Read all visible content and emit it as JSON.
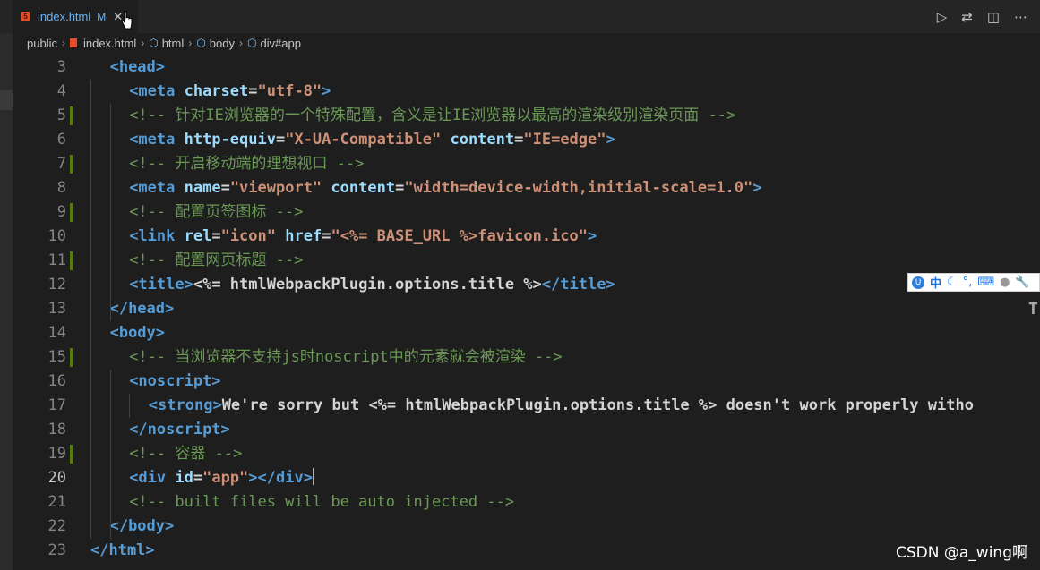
{
  "tab": {
    "file_name": "index.html",
    "modified_flag": "M",
    "file_icon": "html5-icon",
    "close_icon": "close-icon"
  },
  "toolbar": {
    "icons": [
      "run-icon",
      "compare-changes-icon",
      "split-editor-icon",
      "more-icon"
    ]
  },
  "breadcrumb": {
    "items": [
      "public",
      "index.html",
      "html",
      "body",
      "div#app"
    ]
  },
  "editor": {
    "active_line": 20,
    "lines": [
      {
        "num": "3",
        "tokens": [
          {
            "cls": "t",
            "text": "<head>"
          }
        ]
      },
      {
        "num": "4",
        "tokens": [
          {
            "cls": "t",
            "text": "<meta "
          },
          {
            "cls": "a",
            "text": "charset"
          },
          {
            "cls": "txt",
            "text": "="
          },
          {
            "cls": "s",
            "text": "\"utf-8\""
          },
          {
            "cls": "t",
            "text": ">"
          }
        ]
      },
      {
        "num": "5",
        "tokens": [
          {
            "cls": "c",
            "text": "<!-- 针对IE浏览器的一个特殊配置，含义是让IE浏览器以最高的渲染级别渲染页面 -->"
          }
        ]
      },
      {
        "num": "6",
        "tokens": [
          {
            "cls": "t",
            "text": "<meta "
          },
          {
            "cls": "a",
            "text": "http-equiv"
          },
          {
            "cls": "txt",
            "text": "="
          },
          {
            "cls": "s",
            "text": "\"X-UA-Compatible\""
          },
          {
            "cls": "txt",
            "text": " "
          },
          {
            "cls": "a",
            "text": "content"
          },
          {
            "cls": "txt",
            "text": "="
          },
          {
            "cls": "s",
            "text": "\"IE=edge\""
          },
          {
            "cls": "t",
            "text": ">"
          }
        ]
      },
      {
        "num": "7",
        "tokens": [
          {
            "cls": "c",
            "text": "<!-- 开启移动端的理想视口 -->"
          }
        ]
      },
      {
        "num": "8",
        "tokens": [
          {
            "cls": "t",
            "text": "<meta "
          },
          {
            "cls": "a",
            "text": "name"
          },
          {
            "cls": "txt",
            "text": "="
          },
          {
            "cls": "s",
            "text": "\"viewport\""
          },
          {
            "cls": "txt",
            "text": " "
          },
          {
            "cls": "a",
            "text": "content"
          },
          {
            "cls": "txt",
            "text": "="
          },
          {
            "cls": "s",
            "text": "\"width=device-width,initial-scale=1.0\""
          },
          {
            "cls": "t",
            "text": ">"
          }
        ]
      },
      {
        "num": "9",
        "tokens": [
          {
            "cls": "c",
            "text": "<!-- 配置页签图标 -->"
          }
        ]
      },
      {
        "num": "10",
        "tokens": [
          {
            "cls": "t",
            "text": "<link "
          },
          {
            "cls": "a",
            "text": "rel"
          },
          {
            "cls": "txt",
            "text": "="
          },
          {
            "cls": "s",
            "text": "\"icon\""
          },
          {
            "cls": "txt",
            "text": " "
          },
          {
            "cls": "a",
            "text": "href"
          },
          {
            "cls": "txt",
            "text": "="
          },
          {
            "cls": "s",
            "text": "\"<%= BASE_URL %>favicon.ico\""
          },
          {
            "cls": "t",
            "text": ">"
          }
        ]
      },
      {
        "num": "11",
        "tokens": [
          {
            "cls": "c",
            "text": "<!-- 配置网页标题 -->"
          }
        ]
      },
      {
        "num": "12",
        "tokens": [
          {
            "cls": "t",
            "text": "<title>"
          },
          {
            "cls": "txt",
            "text": "<%= htmlWebpackPlugin.options.title %>"
          },
          {
            "cls": "t",
            "text": "</title>"
          }
        ]
      },
      {
        "num": "13",
        "tokens": [
          {
            "cls": "t",
            "text": "</head>"
          }
        ]
      },
      {
        "num": "14",
        "tokens": [
          {
            "cls": "t",
            "text": "<body>"
          }
        ]
      },
      {
        "num": "15",
        "tokens": [
          {
            "cls": "c",
            "text": "<!-- 当浏览器不支持js时noscript中的元素就会被渲染 -->"
          }
        ]
      },
      {
        "num": "16",
        "tokens": [
          {
            "cls": "t",
            "text": "<noscript>"
          }
        ]
      },
      {
        "num": "17",
        "tokens": [
          {
            "cls": "t",
            "text": "<strong>"
          },
          {
            "cls": "txt",
            "text": "We're sorry but <%= htmlWebpackPlugin.options.title %> doesn't work properly witho"
          }
        ]
      },
      {
        "num": "18",
        "tokens": [
          {
            "cls": "t",
            "text": "</noscript>"
          }
        ]
      },
      {
        "num": "19",
        "tokens": [
          {
            "cls": "c",
            "text": "<!-- 容器 -->"
          }
        ]
      },
      {
        "num": "20",
        "tokens": [
          {
            "cls": "t",
            "text": "<div "
          },
          {
            "cls": "a",
            "text": "id"
          },
          {
            "cls": "txt",
            "text": "="
          },
          {
            "cls": "s",
            "text": "\"app\""
          },
          {
            "cls": "t",
            "text": "></div>"
          }
        ]
      },
      {
        "num": "21",
        "tokens": [
          {
            "cls": "c",
            "text": "<!-- built files will be auto injected -->"
          }
        ]
      },
      {
        "num": "22",
        "tokens": [
          {
            "cls": "t",
            "text": "</body>"
          }
        ]
      },
      {
        "num": "23",
        "tokens": [
          {
            "cls": "t",
            "text": "</html>"
          }
        ]
      }
    ]
  },
  "ime_toolbar": {
    "logo": "U",
    "mode_label": "中",
    "icons": [
      "sogou-logo-icon",
      "moon-icon",
      "punctuation-icon",
      "keyboard-icon",
      "user-icon",
      "wrench-icon"
    ]
  },
  "watermark": "CSDN @a_wing啊"
}
